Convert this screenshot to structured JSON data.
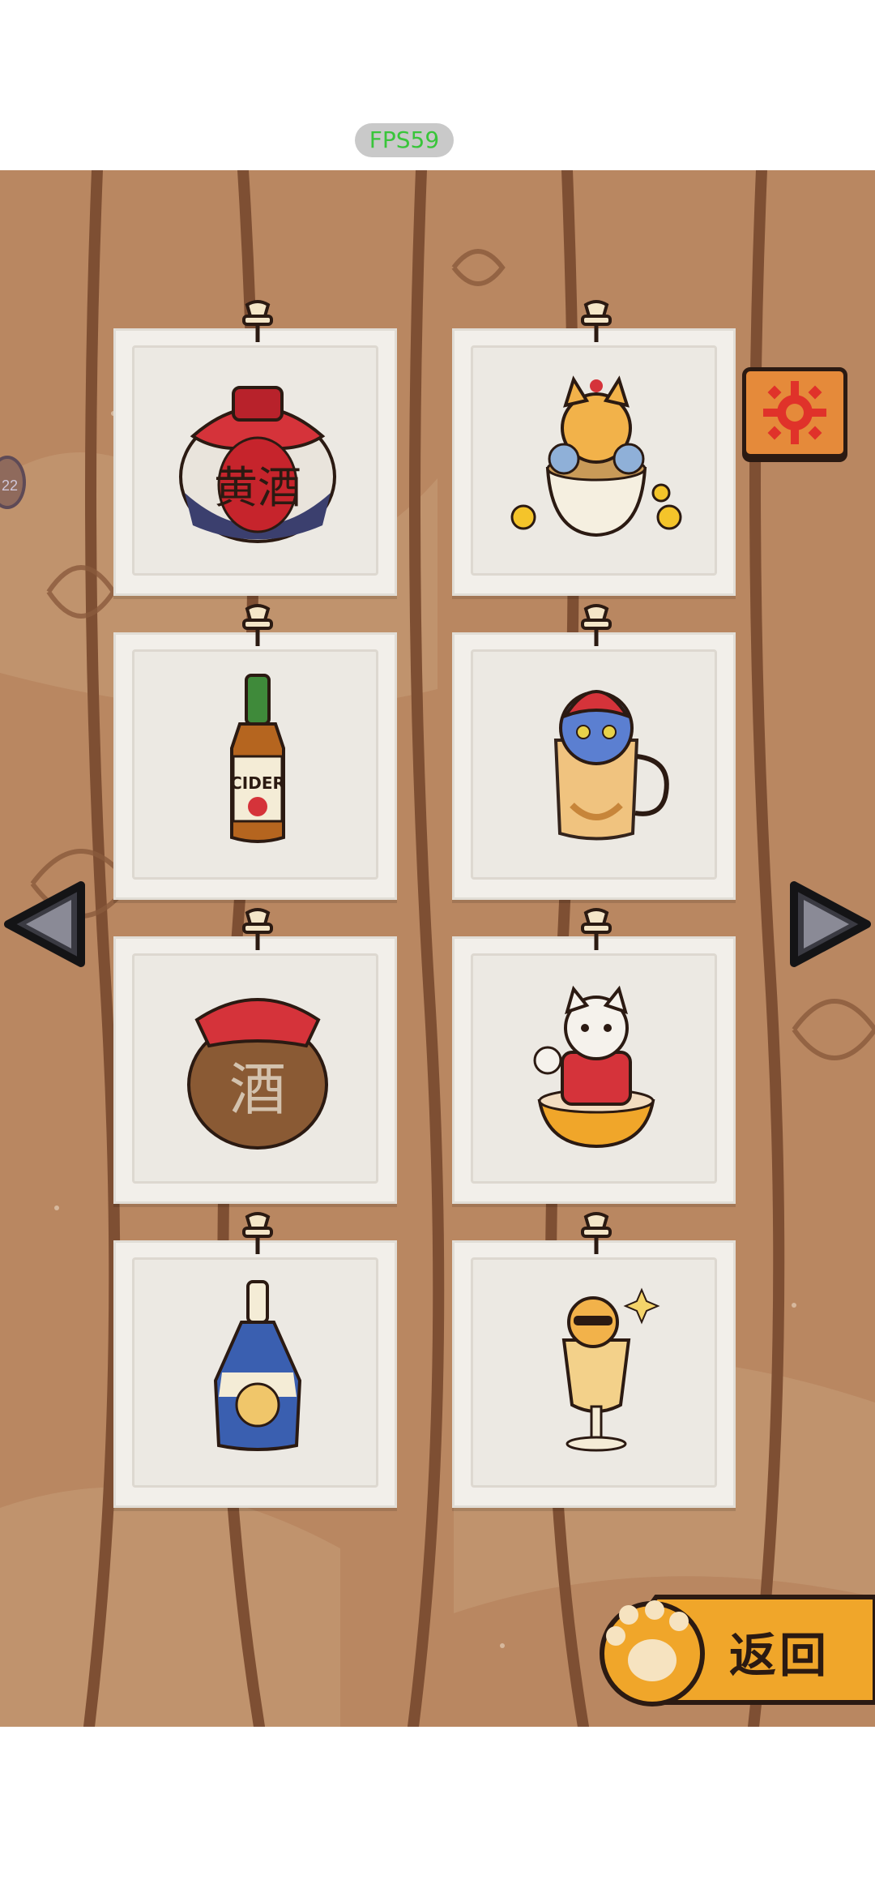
{
  "status": {
    "fps_text": "FPS59"
  },
  "side_badge": {
    "text": "22"
  },
  "collection": {
    "items": [
      {
        "kind": "wine-jar",
        "label": "黄酒"
      },
      {
        "kind": "coin-cat-cup",
        "label": ""
      },
      {
        "kind": "cider-bottle",
        "label": "CIDER"
      },
      {
        "kind": "apple-cat-mug",
        "label": ""
      },
      {
        "kind": "liquor-jar",
        "label": "酒"
      },
      {
        "kind": "red-coat-cat-bowl",
        "label": ""
      },
      {
        "kind": "cat-label-bottle",
        "label": ""
      },
      {
        "kind": "sunglasses-cat-glass",
        "label": ""
      }
    ]
  },
  "controls": {
    "back_label": "返回"
  },
  "colors": {
    "board": "#b98761",
    "plank_line": "#7e4f33",
    "card": "#f2efea",
    "accent_orange": "#f0a62a",
    "settings_orange": "#e58a3a",
    "outline": "#2b1a12",
    "fps_green": "#39c53a"
  },
  "icons": {
    "settings": "gear-icon",
    "prev": "arrow-left-icon",
    "next": "arrow-right-icon",
    "back": "paw-icon",
    "pin": "pushpin-icon"
  }
}
